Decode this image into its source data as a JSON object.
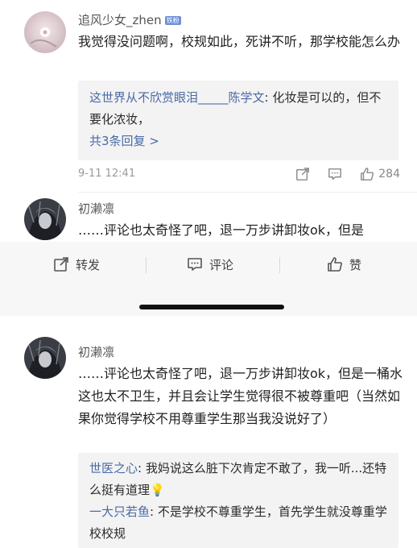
{
  "comments": [
    {
      "username": "追风少女_zhen",
      "badge": "铁粉",
      "text": "我觉得没问题啊，校规如此，死讲不听，那学校能怎么办",
      "reply_preview": {
        "user": "这世界从不欣赏眼泪_____陈学文",
        "colon": ": ",
        "text": "化妆是可以的，但不要化浓妆，",
        "more": "共3条回复 >"
      },
      "time": "9-11 12:41",
      "like_count": "284",
      "icons": [
        "share-icon",
        "comment-icon",
        "like-icon"
      ]
    },
    {
      "username": "初濑凛",
      "text_preview": "……评论也太奇怪了吧，退一万步讲卸妆ok，但是"
    }
  ],
  "action_bar": {
    "forward": "转发",
    "comment": "评论",
    "like": "赞"
  },
  "expanded": {
    "username": "初濑凛",
    "text": "……评论也太奇怪了吧，退一万步讲卸妆ok，但是一桶水这也太不卫生，并且会让学生觉得很不被尊重吧（当然如果你觉得学校不用尊重学生那当我没说好了）",
    "replies": [
      {
        "user": "世医之心",
        "colon": ": ",
        "text": "我妈说这么脏下次肯定不敢了，我一听...还特么挺有道理",
        "emoji": "💡"
      },
      {
        "user": "一大只若鱼",
        "colon": ": ",
        "text": "不是学校不尊重学生，首先学生就没尊重学校校规"
      }
    ]
  },
  "colors": {
    "link_blue": "#4a6aa5",
    "badge_blue": "#6e8fd8",
    "reply_bg": "#f3f3f3",
    "bar_bg": "#f7f7f7"
  }
}
